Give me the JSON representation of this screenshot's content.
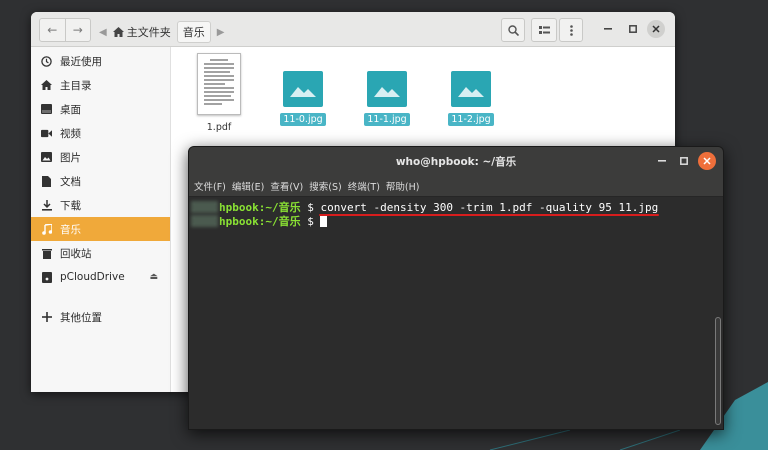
{
  "file_manager": {
    "nav": {
      "back_icon": "←",
      "forward_icon": "→",
      "prev_icon": "◀"
    },
    "breadcrumb": {
      "home": "主文件夹",
      "current": "音乐",
      "next_icon": "▶"
    },
    "sidebar": {
      "items": [
        {
          "icon": "clock-icon",
          "label": "最近使用"
        },
        {
          "icon": "home-icon",
          "label": "主目录"
        },
        {
          "icon": "desktop-icon",
          "label": "桌面"
        },
        {
          "icon": "video-icon",
          "label": "视频"
        },
        {
          "icon": "picture-icon",
          "label": "图片"
        },
        {
          "icon": "document-icon",
          "label": "文档"
        },
        {
          "icon": "download-icon",
          "label": "下载"
        },
        {
          "icon": "music-icon",
          "label": "音乐",
          "active": true
        },
        {
          "icon": "trash-icon",
          "label": "回收站"
        },
        {
          "icon": "drive-icon",
          "label": "pCloudDrive",
          "eject": true
        }
      ],
      "other": {
        "icon": "plus-icon",
        "label": "其他位置"
      }
    },
    "files": [
      {
        "name": "1.pdf",
        "type": "pdf",
        "selected": false
      },
      {
        "name": "11-0.jpg",
        "type": "image",
        "selected": true
      },
      {
        "name": "11-1.jpg",
        "type": "image",
        "selected": true
      },
      {
        "name": "11-2.jpg",
        "type": "image",
        "selected": true
      }
    ]
  },
  "terminal": {
    "title": "who@hpbook: ~/音乐",
    "menu": [
      "文件(F)",
      "编辑(E)",
      "查看(V)",
      "搜索(S)",
      "终端(T)",
      "帮助(H)"
    ],
    "lines": [
      {
        "prompt": "hpbook:~/音乐",
        "symbol": "$",
        "command": "convert -density 300 -trim 1.pdf -quality 95 11.jpg"
      },
      {
        "prompt": "hpbook:~/音乐",
        "symbol": "$",
        "command": ""
      }
    ]
  },
  "colors": {
    "accent_orange": "#f0a93a",
    "selection_teal": "#49b5c6",
    "image_icon": "#2aa6b3",
    "terminal_bg": "#2c2c2c",
    "prompt_green": "#8ae234",
    "annotation_red": "#d81d1d",
    "close_button": "#ef6f3b"
  }
}
